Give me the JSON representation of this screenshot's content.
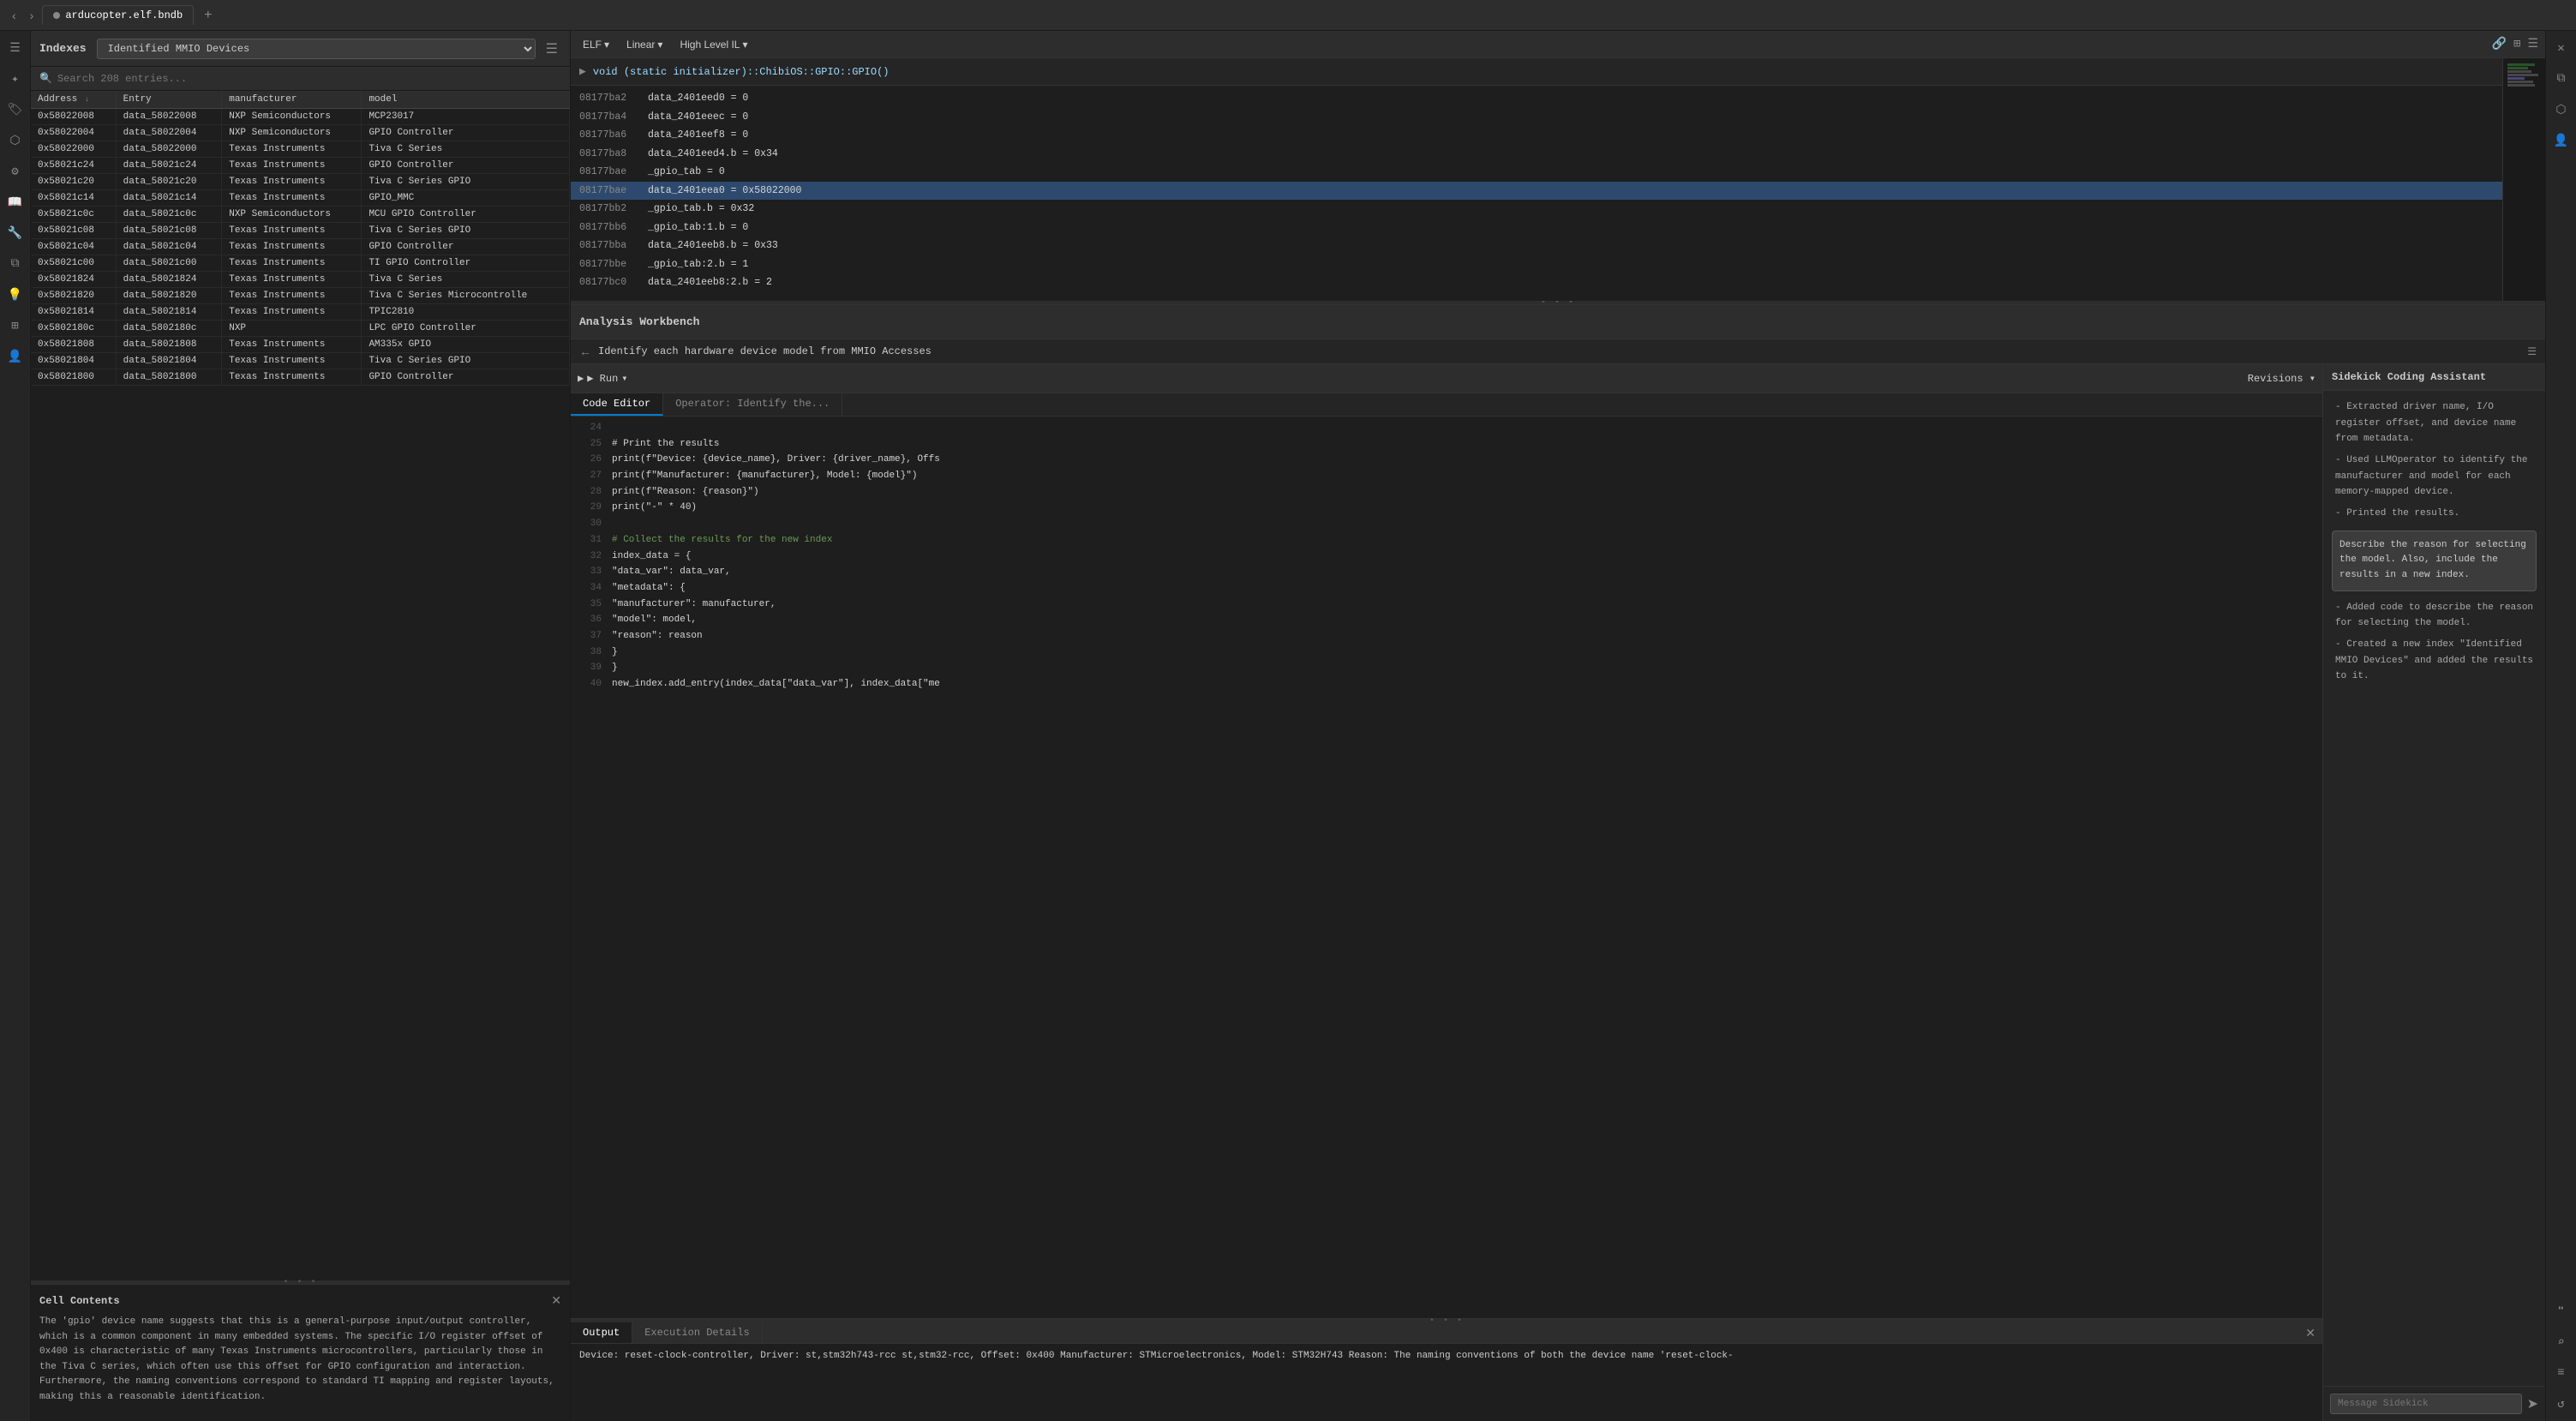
{
  "tabBar": {
    "backBtn": "‹",
    "forwardBtn": "›",
    "tab": {
      "label": "arducopter.elf.bndb",
      "dotColor": "#888"
    },
    "addBtn": "+"
  },
  "leftPanel": {
    "indexesTitle": "Indexes",
    "dropdown": {
      "value": "Identified MMIO Devices"
    },
    "search": {
      "placeholder": "Search 208 entries..."
    },
    "table": {
      "columns": [
        {
          "label": "Address",
          "sort": "↓"
        },
        {
          "label": "Entry"
        },
        {
          "label": "manufacturer"
        },
        {
          "label": "model"
        }
      ],
      "rows": [
        {
          "address": "0x58022008",
          "entry": "data_58022008",
          "manufacturer": "NXP Semiconductors",
          "model": "MCP23017"
        },
        {
          "address": "0x58022004",
          "entry": "data_58022004",
          "manufacturer": "NXP Semiconductors",
          "model": "GPIO Controller"
        },
        {
          "address": "0x58022000",
          "entry": "data_58022000",
          "manufacturer": "Texas Instruments",
          "model": "Tiva C Series"
        },
        {
          "address": "0x58021c24",
          "entry": "data_58021c24",
          "manufacturer": "Texas Instruments",
          "model": "GPIO Controller"
        },
        {
          "address": "0x58021c20",
          "entry": "data_58021c20",
          "manufacturer": "Texas Instruments",
          "model": "Tiva C Series GPIO"
        },
        {
          "address": "0x58021c14",
          "entry": "data_58021c14",
          "manufacturer": "Texas Instruments",
          "model": "GPIO_MMC"
        },
        {
          "address": "0x58021c0c",
          "entry": "data_58021c0c",
          "manufacturer": "NXP Semiconductors",
          "model": "MCU GPIO Controller"
        },
        {
          "address": "0x58021c08",
          "entry": "data_58021c08",
          "manufacturer": "Texas Instruments",
          "model": "Tiva C Series GPIO"
        },
        {
          "address": "0x58021c04",
          "entry": "data_58021c04",
          "manufacturer": "Texas Instruments",
          "model": "GPIO Controller"
        },
        {
          "address": "0x58021c00",
          "entry": "data_58021c00",
          "manufacturer": "Texas Instruments",
          "model": "TI GPIO Controller"
        },
        {
          "address": "0x58021824",
          "entry": "data_58021824",
          "manufacturer": "Texas Instruments",
          "model": "Tiva C Series"
        },
        {
          "address": "0x58021820",
          "entry": "data_58021820",
          "manufacturer": "Texas Instruments",
          "model": "Tiva C Series Microcontrolle"
        },
        {
          "address": "0x58021814",
          "entry": "data_58021814",
          "manufacturer": "Texas Instruments",
          "model": "TPIC2810"
        },
        {
          "address": "0x5802180c",
          "entry": "data_5802180c",
          "manufacturer": "NXP",
          "model": "LPC GPIO Controller"
        },
        {
          "address": "0x58021808",
          "entry": "data_58021808",
          "manufacturer": "Texas Instruments",
          "model": "AM335x GPIO"
        },
        {
          "address": "0x58021804",
          "entry": "data_58021804",
          "manufacturer": "Texas Instruments",
          "model": "Tiva C Series GPIO"
        },
        {
          "address": "0x58021800",
          "entry": "data_58021800",
          "manufacturer": "Texas Instruments",
          "model": "GPIO Controller"
        }
      ]
    },
    "cellContents": {
      "title": "Cell Contents",
      "text": "The 'gpio' device name suggests that this is a general-purpose input/output controller, which is a common component in many embedded systems. The specific I/O register offset of 0x400 is characteristic of many Texas Instruments microcontrollers, particularly those in the Tiva C series, which often use this offset for GPIO configuration and interaction. Furthermore, the naming conventions correspond to standard TI mapping and register layouts, making this a reasonable identification."
    }
  },
  "rightPanel": {
    "disasm": {
      "toolbar": {
        "elfBtn": "ELF",
        "elfArrow": "▾",
        "linearBtn": "Linear",
        "linearArrow": "▾",
        "highLevelBtn": "High Level IL",
        "highLevelArrow": "▾"
      },
      "funcHeader": "void (static initializer)::ChibiOS::GPIO::GPIO()",
      "lines": [
        {
          "addr": "08177ba2",
          "code": "data_2401eed0 = 0",
          "highlighted": false
        },
        {
          "addr": "08177ba4",
          "code": "data_2401eeec = 0",
          "highlighted": false
        },
        {
          "addr": "08177ba6",
          "code": "data_2401eef8 = 0",
          "highlighted": false
        },
        {
          "addr": "08177ba8",
          "code": "data_2401eed4.b = 0x34",
          "highlighted": false
        },
        {
          "addr": "08177bae",
          "code": "_gpio_tab = 0",
          "highlighted": false
        },
        {
          "addr": "08177bae",
          "code": "data_2401eea0 = 0x58022000",
          "highlighted": true
        },
        {
          "addr": "08177bb2",
          "code": "_gpio_tab.b = 0x32",
          "highlighted": false
        },
        {
          "addr": "08177bb6",
          "code": "_gpio_tab:1.b = 0",
          "highlighted": false
        },
        {
          "addr": "08177bba",
          "code": "data_2401eeb8.b = 0x33",
          "highlighted": false
        },
        {
          "addr": "08177bbe",
          "code": "_gpio_tab:2.b = 1",
          "highlighted": false
        },
        {
          "addr": "08177bc0",
          "code": "data_2401eeb8:2.b = 2",
          "highlighted": false
        }
      ]
    },
    "workbench": {
      "title": "Analysis Workbench",
      "task": "Identify each hardware device model from MMIO Accesses",
      "runBtn": "▶ Run",
      "runArrow": "▾",
      "revisionsBtn": "Revisions",
      "revisionsArrow": "▾",
      "sidekickTitle": "Sidekick Coding Assistant",
      "tabs": {
        "codeEditor": "Code Editor",
        "operator": "Operator: Identify the..."
      },
      "codeLines": [
        {
          "num": "24",
          "code": ""
        },
        {
          "num": "25",
          "code": "    # Print the results"
        },
        {
          "num": "26",
          "code": "    print(f\"Device: {device_name}, Driver: {driver_name}, Offs"
        },
        {
          "num": "27",
          "code": "    print(f\"Manufacturer: {manufacturer}, Model: {model}\")"
        },
        {
          "num": "28",
          "code": "    print(f\"Reason: {reason}\")"
        },
        {
          "num": "29",
          "code": "    print(\"-\" * 40)"
        },
        {
          "num": "30",
          "code": ""
        },
        {
          "num": "31",
          "code": "    # Collect the results for the new index",
          "comment": true
        },
        {
          "num": "32",
          "code": "    index_data = {"
        },
        {
          "num": "33",
          "code": "        \"data_var\": data_var,"
        },
        {
          "num": "34",
          "code": "        \"metadata\": {"
        },
        {
          "num": "35",
          "code": "            \"manufacturer\": manufacturer,"
        },
        {
          "num": "36",
          "code": "            \"model\": model,"
        },
        {
          "num": "37",
          "code": "            \"reason\": reason"
        },
        {
          "num": "38",
          "code": "        }"
        },
        {
          "num": "39",
          "code": "    }"
        },
        {
          "num": "40",
          "code": "    new_index.add_entry(index_data[\"data_var\"], index_data[\"me"
        }
      ],
      "output": {
        "tabs": [
          "Output",
          "Execution Details"
        ],
        "activeTab": "Output",
        "text": "Device: reset-clock-controller, Driver: st,stm32h743-rcc st,stm32-rcc,\nOffset: 0x400\nManufacturer: STMicroelectronics, Model: STM32H743\nReason: The naming conventions of both the device name 'reset-clock-"
      },
      "sidekick": {
        "bullets": [
          "- Extracted driver name, I/O register offset, and device name from metadata.",
          "- Used LLMOperator to identify the manufacturer and model for each memory-mapped device.",
          "- Printed the results."
        ],
        "tooltip": "Describe the reason for selecting the model. Also, include the results in a new index.",
        "bullets2": [
          "- Added code to describe the reason for selecting the model.",
          "- Created a new index \"Identified MMIO Devices\" and added the results to it."
        ],
        "messagePlaceholder": "Message Sidekick"
      }
    }
  },
  "icons": {
    "hamburger": "☰",
    "search": "🔍",
    "back": "←",
    "forward": "→",
    "settings": "⚙",
    "close": "✕",
    "play": "▶",
    "chevronDown": "▾",
    "menu": "⋯",
    "link": "🔗",
    "send": "➤",
    "bookmark": "🔖",
    "tag": "🏷",
    "graph": "⬡",
    "gear": "⚙",
    "layers": "⧉",
    "bulb": "💡",
    "wrench": "🔧",
    "grid": "⊞",
    "person": "👤",
    "plugin": "🔌",
    "quote": "❝",
    "list": "≡",
    "undo": "↺",
    "zoomSearch": "⌕"
  }
}
